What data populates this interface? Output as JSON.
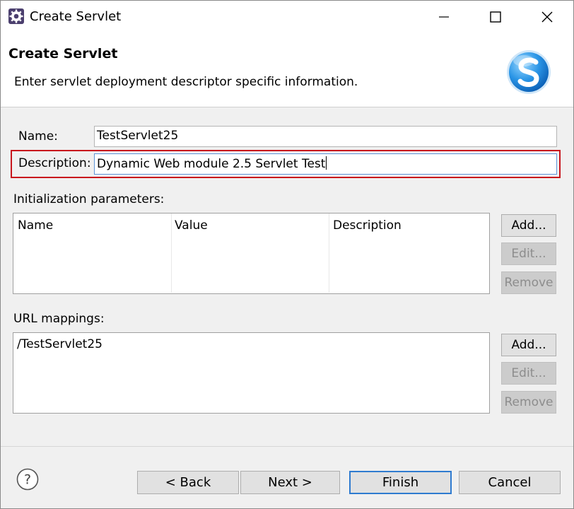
{
  "window": {
    "title": "Create Servlet",
    "icon": "eclipse-gear-icon"
  },
  "title_bar_buttons": {
    "minimize": "minimize-icon",
    "maximize": "maximize-icon",
    "close": "close-icon"
  },
  "banner": {
    "title": "Create Servlet",
    "description": "Enter servlet deployment descriptor specific information.",
    "logo": "servlet-s-logo-icon"
  },
  "form": {
    "name_label": "Name:",
    "name_value": "TestServlet25",
    "description_label": "Description:",
    "description_value": "Dynamic Web module 2.5 Servlet Test"
  },
  "init_params": {
    "label": "Initialization parameters:",
    "columns": [
      "Name",
      "Value",
      "Description"
    ],
    "rows": [],
    "buttons": {
      "add": "Add...",
      "edit": "Edit...",
      "remove": "Remove"
    }
  },
  "url_mappings": {
    "label": "URL mappings:",
    "items": [
      "/TestServlet25"
    ],
    "buttons": {
      "add": "Add...",
      "edit": "Edit...",
      "remove": "Remove"
    }
  },
  "footer": {
    "help": "help-icon",
    "back": "< Back",
    "next": "Next >",
    "finish": "Finish",
    "cancel": "Cancel"
  },
  "colors": {
    "highlight": "#c8161d",
    "default_button_border": "#2f7bd0",
    "logo_blue": "#1f8be0"
  }
}
